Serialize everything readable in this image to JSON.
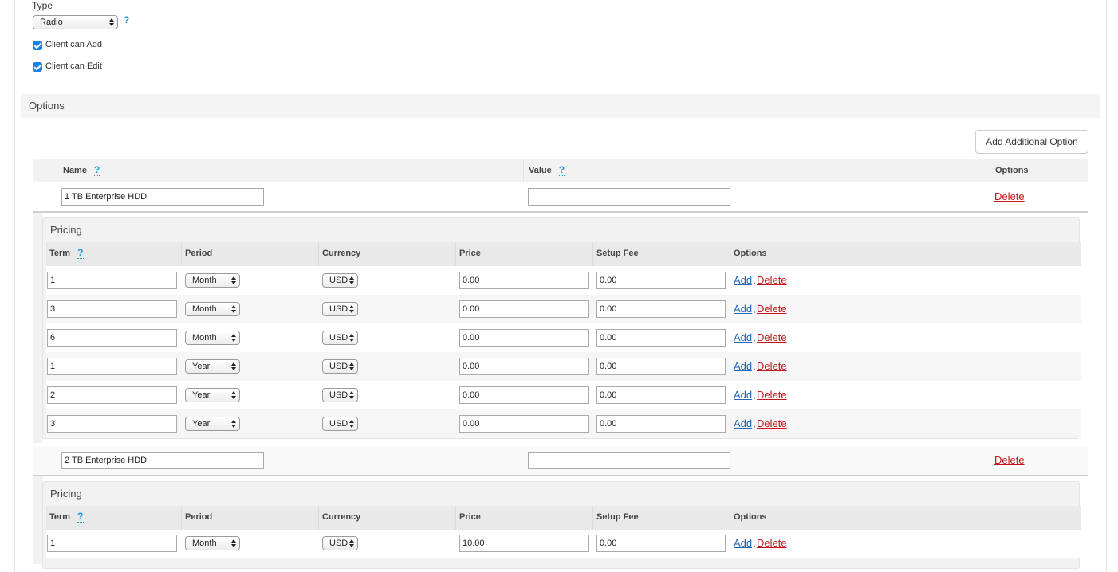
{
  "field": {
    "type_label": "Type",
    "type_value": "Radio",
    "help": "?",
    "client_can_add_label": "Client can Add",
    "client_can_edit_label": "Client can Edit"
  },
  "options_section": {
    "title": "Options",
    "add_button": "Add Additional Option",
    "headers": {
      "name": "Name",
      "value": "Value",
      "options": "Options"
    }
  },
  "pricing_headers": {
    "title": "Pricing",
    "term": "Term",
    "period": "Period",
    "currency": "Currency",
    "price": "Price",
    "setup_fee": "Setup Fee",
    "options": "Options"
  },
  "links": {
    "add": "Add",
    "delete": "Delete",
    "comma": ","
  },
  "options": [
    {
      "name": "1 TB Enterprise HDD",
      "value": "",
      "pricing": [
        {
          "term": "1",
          "period": "Month",
          "currency": "USD",
          "price": "0.00",
          "setup_fee": "0.00"
        },
        {
          "term": "3",
          "period": "Month",
          "currency": "USD",
          "price": "0.00",
          "setup_fee": "0.00"
        },
        {
          "term": "6",
          "period": "Month",
          "currency": "USD",
          "price": "0.00",
          "setup_fee": "0.00"
        },
        {
          "term": "1",
          "period": "Year",
          "currency": "USD",
          "price": "0.00",
          "setup_fee": "0.00"
        },
        {
          "term": "2",
          "period": "Year",
          "currency": "USD",
          "price": "0.00",
          "setup_fee": "0.00"
        },
        {
          "term": "3",
          "period": "Year",
          "currency": "USD",
          "price": "0.00",
          "setup_fee": "0.00"
        }
      ]
    },
    {
      "name": "2 TB Enterprise HDD",
      "value": "",
      "pricing": [
        {
          "term": "1",
          "period": "Month",
          "currency": "USD",
          "price": "10.00",
          "setup_fee": "0.00"
        }
      ]
    }
  ],
  "colors": {
    "link_add": "#2468b4",
    "link_delete": "#c1161c",
    "help": "#1e9ad6",
    "checkbox": "#1a82e2"
  }
}
